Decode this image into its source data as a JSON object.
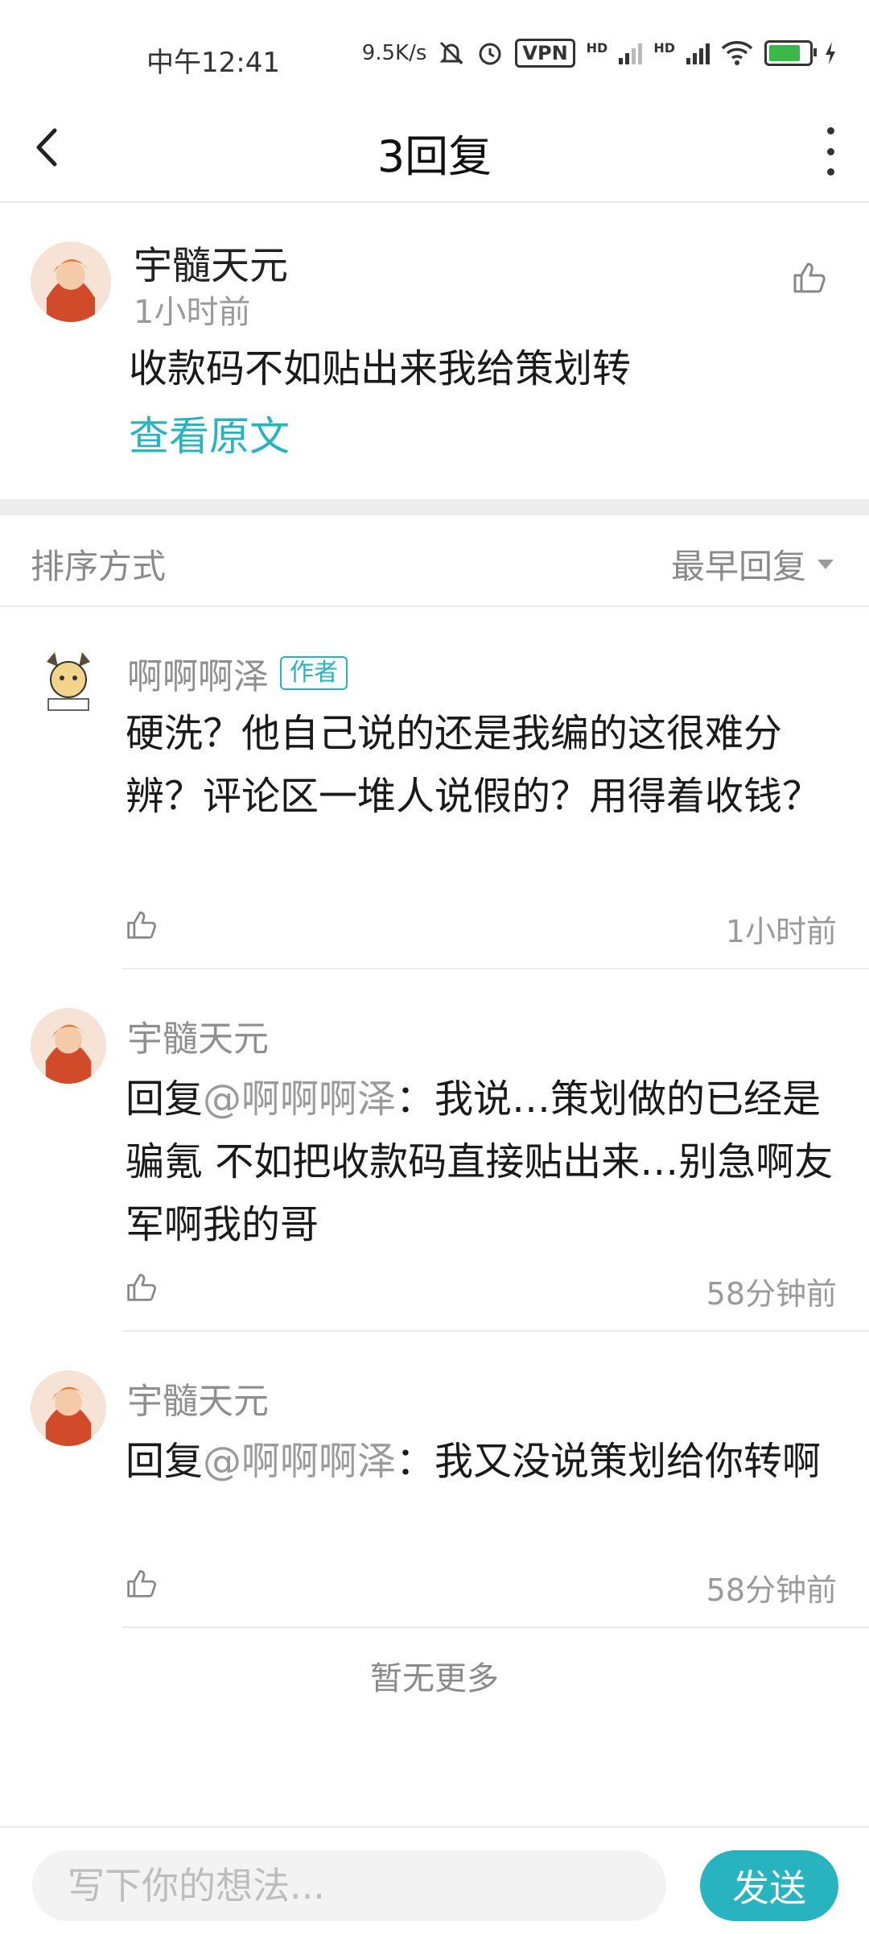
{
  "status_bar": {
    "time": "中午12:41",
    "net_speed": "9.5K/s",
    "vpn": "VPN",
    "hd1": "HD",
    "hd2": "HD"
  },
  "header": {
    "title": "3回复"
  },
  "original": {
    "author": "宇髓天元",
    "time": "1小时前",
    "text": "收款码不如贴出来我给策划转",
    "view_original": "查看原文"
  },
  "sort": {
    "label": "排序方式",
    "selected": "最早回复"
  },
  "replies": [
    {
      "author": "啊啊啊泽",
      "tag": "作者",
      "text": "硬洗？他自己说的还是我编的这很难分辨？评论区一堆人说假的？用得着收钱？",
      "time": "1小时前"
    },
    {
      "author": "宇髓天元",
      "reply_prefix": "回复",
      "mention": "@啊啊啊泽",
      "text": "：我说…策划做的已经是骗氪 不如把收款码直接贴出来…别急啊友军啊我的哥",
      "time": "58分钟前"
    },
    {
      "author": "宇髓天元",
      "reply_prefix": "回复",
      "mention": "@啊啊啊泽",
      "text": "：我又没说策划给你转啊",
      "time": "58分钟前"
    }
  ],
  "footer": {
    "no_more": "暂无更多"
  },
  "input": {
    "placeholder": "写下你的想法...",
    "send_label": "发送"
  },
  "colors": {
    "accent": "#27b3c0",
    "muted": "#9a9a9a"
  }
}
